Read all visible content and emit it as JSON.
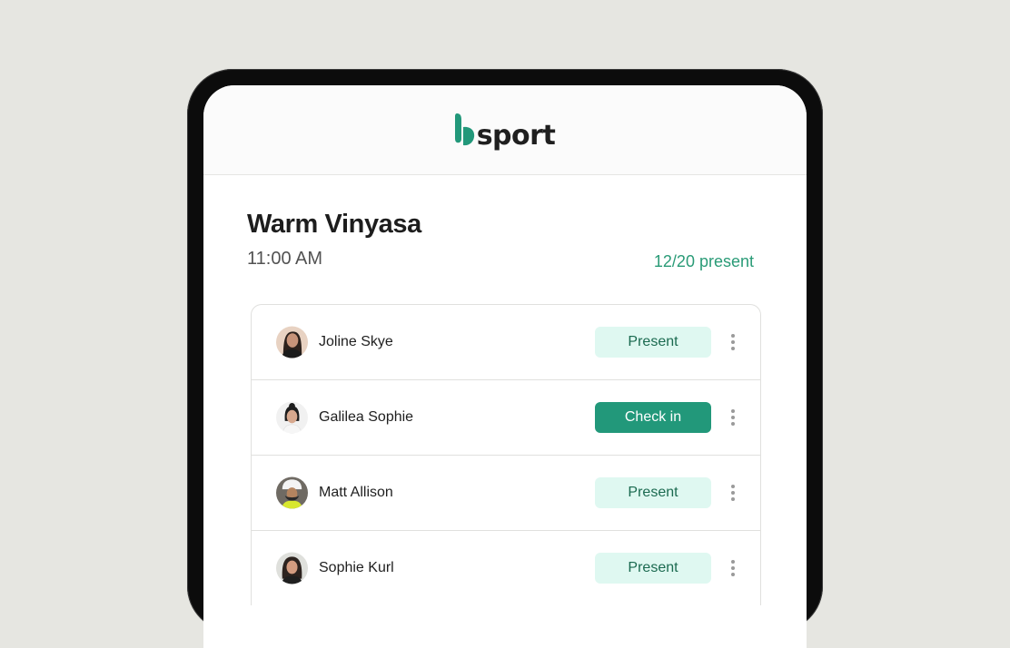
{
  "brand": {
    "name": "sport",
    "accent": "#22987a"
  },
  "class": {
    "title": "Warm Vinyasa",
    "time": "11:00 AM",
    "attendance": "12/20 present"
  },
  "attendees": [
    {
      "name": "Joline Skye",
      "status": "Present",
      "state": "present",
      "avatar_icon": "avatar-joline"
    },
    {
      "name": "Galilea Sophie",
      "status": "Check in",
      "state": "checkin",
      "avatar_icon": "avatar-galilea"
    },
    {
      "name": "Matt Allison",
      "status": "Present",
      "state": "present",
      "avatar_icon": "avatar-matt"
    },
    {
      "name": "Sophie Kurl",
      "status": "Present",
      "state": "present",
      "avatar_icon": "avatar-sophie"
    }
  ],
  "colors": {
    "present_bg": "#dff8f1",
    "present_text": "#1b6a50",
    "checkin_bg": "#22987a",
    "count_text": "#2a9b77"
  }
}
